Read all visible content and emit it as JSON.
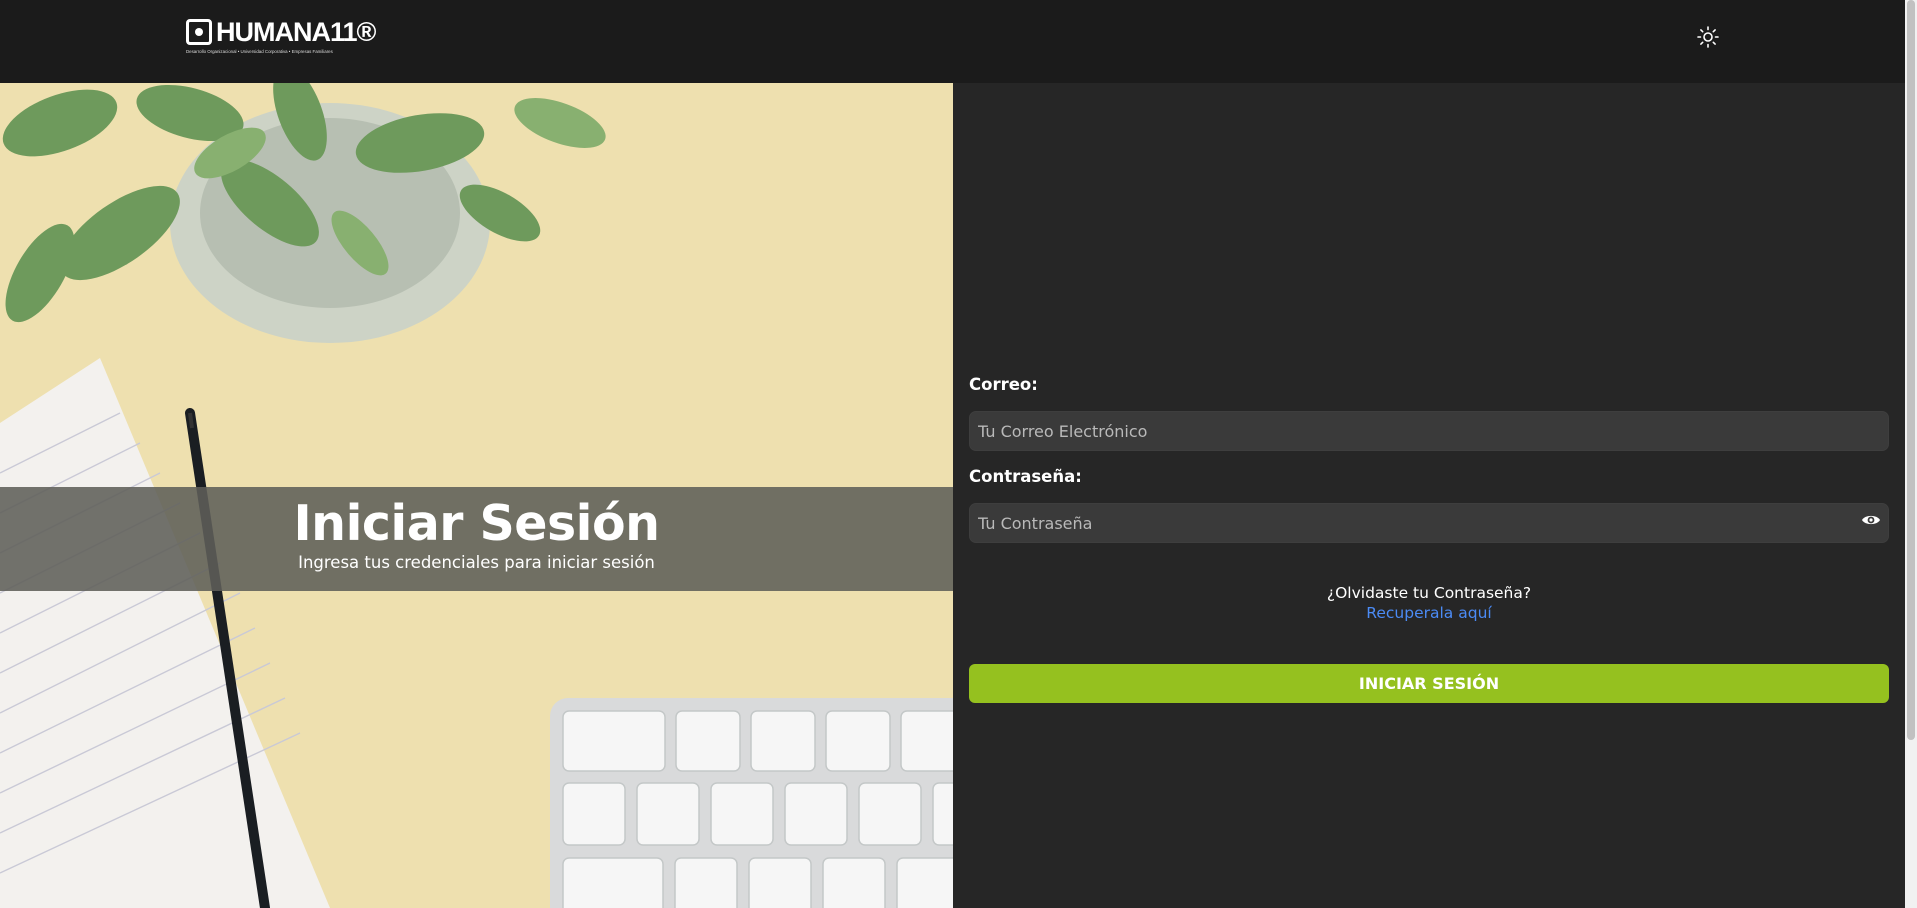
{
  "header": {
    "logo_text": "HUMANA11®",
    "logo_tagline": "Desarrollo Organizacional • Universidad Corporativa • Empresas Familiares",
    "theme_toggle_icon": "sun-icon"
  },
  "hero": {
    "title": "Iniciar Sesión",
    "subtitle": "Ingresa tus credenciales para iniciar sesión"
  },
  "form": {
    "email_label": "Correo:",
    "email_placeholder": "Tu Correo Electrónico",
    "email_value": "",
    "password_label": "Contraseña:",
    "password_placeholder": "Tu Contraseña",
    "password_value": "",
    "password_toggle_icon": "eye-icon",
    "forgot_text": "¿Olvidaste tu Contraseña?",
    "recover_link": "Recuperala aquí",
    "submit_label": "INICIAR SESIÓN"
  },
  "colors": {
    "accent": "#95c11f",
    "link": "#4b8bf5",
    "header_bg": "#1b1b1b",
    "page_bg": "#262626"
  }
}
